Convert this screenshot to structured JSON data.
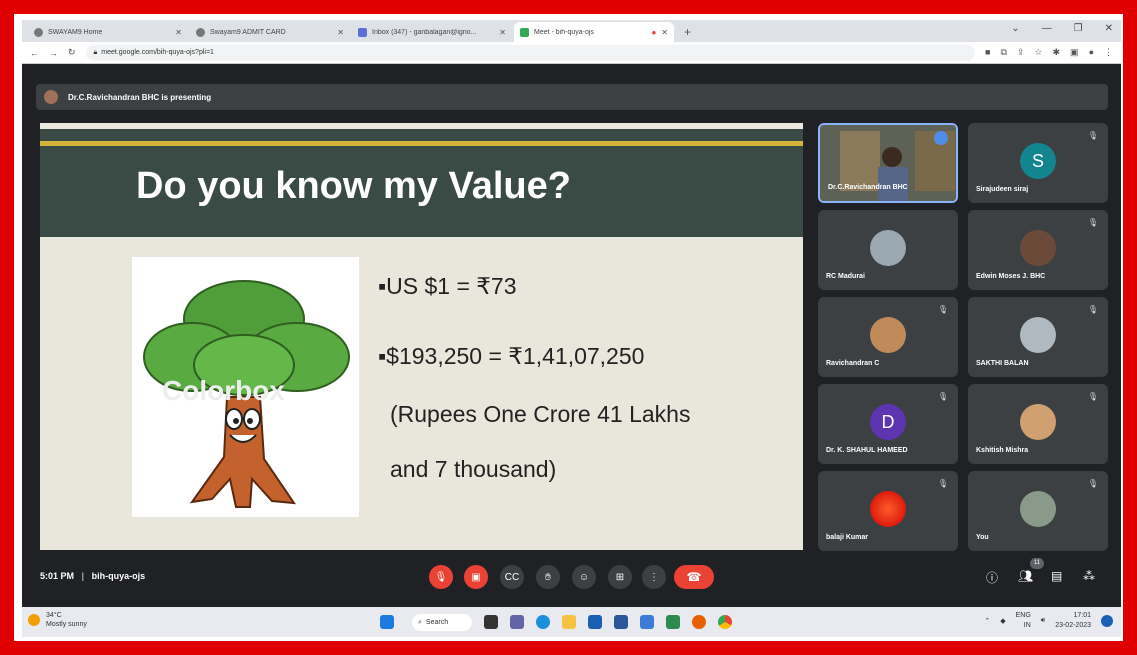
{
  "browser": {
    "tabs": [
      {
        "label": "SWAYAM9 Home",
        "active": false
      },
      {
        "label": "Swayam9 ADMIT CARD",
        "active": false
      },
      {
        "label": "Inbox (347) - ganbalagan@igno...",
        "active": false
      },
      {
        "label": "Meet - bih-quya-ojs",
        "active": true
      }
    ],
    "new_tab": "+",
    "url": "meet.google.com/bih-quya-ojs?pli=1"
  },
  "meet": {
    "presenting": "Dr.C.Ravichandran BHC is presenting",
    "slide": {
      "title": "Do you know my Value?",
      "watermark": "Colorbox",
      "bullet1": "▪US $1 = ₹73",
      "bullet2": "▪$193,250 = ₹1,41,07,250",
      "line3": "(Rupees One Crore 41 Lakhs",
      "line4": "and 7 thousand)"
    },
    "participants": [
      {
        "name": "Dr.C.Ravichandran BHC",
        "initial": ""
      },
      {
        "name": "Sirajudeen siraj",
        "initial": "S"
      },
      {
        "name": "RC Madurai",
        "initial": ""
      },
      {
        "name": "Edwin Moses J. BHC",
        "initial": ""
      },
      {
        "name": "Ravichandran C",
        "initial": ""
      },
      {
        "name": "SAKTHI BALAN",
        "initial": ""
      },
      {
        "name": "Dr. K. SHAHUL HAMEED",
        "initial": "D"
      },
      {
        "name": "Kshitish Mishra",
        "initial": ""
      },
      {
        "name": "balaji Kumar",
        "initial": ""
      },
      {
        "name": "You",
        "initial": ""
      }
    ],
    "time": "5:01 PM",
    "separator": "|",
    "meeting_code": "bih-quya-ojs",
    "participant_count": "11"
  },
  "taskbar": {
    "temp": "34°C",
    "weather": "Mostly sunny",
    "search": "Search",
    "lang1": "ENG",
    "lang2": "IN",
    "time": "17:01",
    "date": "23-02-2023"
  },
  "colors": {
    "frame": "#e00000",
    "meet_bg": "#202124",
    "tile_bg": "#3c4043",
    "red_button": "#ea4335"
  }
}
